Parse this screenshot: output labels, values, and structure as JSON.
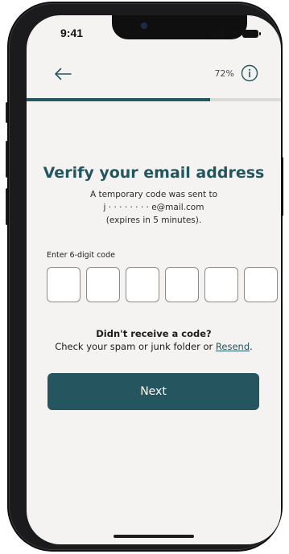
{
  "status_bar": {
    "time": "9:41"
  },
  "header": {
    "back_icon": "arrow-left-icon",
    "progress_label": "72%",
    "progress_value": 0.72,
    "info_icon": "info-circle-icon"
  },
  "verify": {
    "title": "Verify your email address",
    "line1": "A temporary code was sent to",
    "email": "j · · · · · · · · e@mail.com",
    "expires": "(expires in 5 minutes).",
    "code_label": "Enter 6-digit code",
    "code_digits": [
      "",
      "",
      "",
      "",
      "",
      ""
    ],
    "no_code_question": "Didn't receive a code?",
    "no_code_help": "Check your spam or junk folder or ",
    "resend_label": "Resend",
    "after_resend": ".",
    "next_label": "Next"
  },
  "colors": {
    "accent": "#24565f",
    "background": "#f4f3f1",
    "progress_track": "#d9dbd9"
  }
}
